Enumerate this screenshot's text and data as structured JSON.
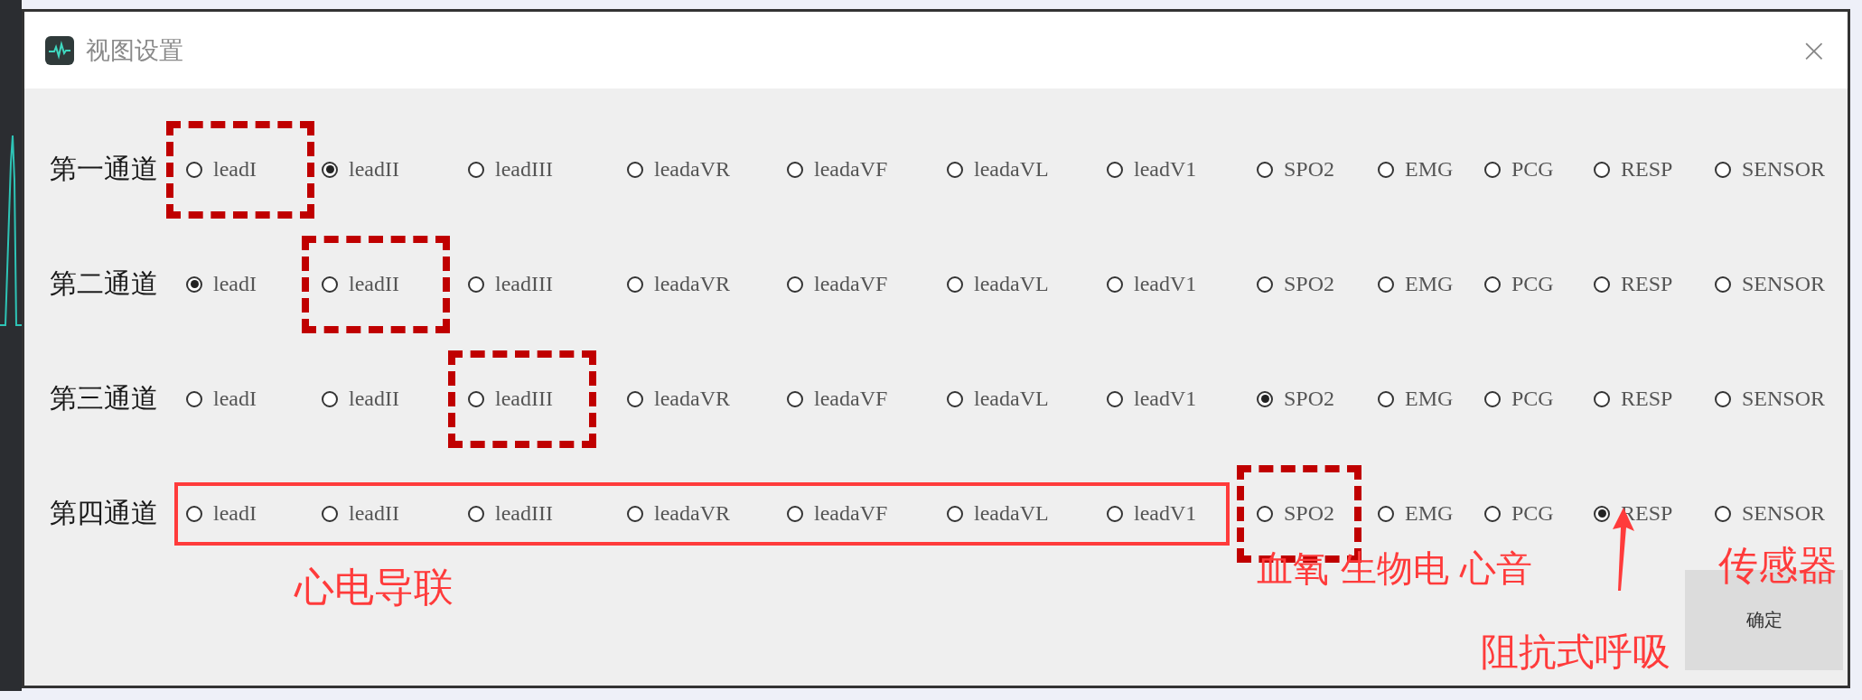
{
  "window": {
    "title": "视图设置",
    "close": "×"
  },
  "channels": [
    {
      "label": "第一通道",
      "options": [
        {
          "kind": "radio",
          "label": "leadI",
          "selected": false,
          "boxed": true
        },
        {
          "kind": "radio",
          "label": "leadII",
          "selected": true,
          "boxed": false
        },
        {
          "kind": "radio",
          "label": "leadIII",
          "selected": false,
          "boxed": false
        },
        {
          "kind": "radio",
          "label": "leadaVR",
          "selected": false,
          "boxed": false
        },
        {
          "kind": "radio",
          "label": "leadaVF",
          "selected": false,
          "boxed": false
        },
        {
          "kind": "radio",
          "label": "leadaVL",
          "selected": false,
          "boxed": false
        },
        {
          "kind": "radio",
          "label": "leadV1",
          "selected": false,
          "boxed": false
        },
        {
          "kind": "radio",
          "label": "SPO2",
          "selected": false,
          "boxed": false
        },
        {
          "kind": "radio",
          "label": "EMG",
          "selected": false,
          "boxed": false
        },
        {
          "kind": "radio",
          "label": "PCG",
          "selected": false,
          "boxed": false
        },
        {
          "kind": "radio",
          "label": "RESP",
          "selected": false,
          "boxed": false
        },
        {
          "kind": "radio",
          "label": "SENSOR",
          "selected": false,
          "boxed": false
        }
      ]
    },
    {
      "label": "第二通道",
      "options": [
        {
          "kind": "radio",
          "label": "leadI",
          "selected": true,
          "boxed": false
        },
        {
          "kind": "radio",
          "label": "leadII",
          "selected": false,
          "boxed": true
        },
        {
          "kind": "radio",
          "label": "leadIII",
          "selected": false,
          "boxed": false
        },
        {
          "kind": "radio",
          "label": "leadaVR",
          "selected": false,
          "boxed": false
        },
        {
          "kind": "radio",
          "label": "leadaVF",
          "selected": false,
          "boxed": false
        },
        {
          "kind": "radio",
          "label": "leadaVL",
          "selected": false,
          "boxed": false
        },
        {
          "kind": "radio",
          "label": "leadV1",
          "selected": false,
          "boxed": false
        },
        {
          "kind": "radio",
          "label": "SPO2",
          "selected": false,
          "boxed": false
        },
        {
          "kind": "radio",
          "label": "EMG",
          "selected": false,
          "boxed": false
        },
        {
          "kind": "radio",
          "label": "PCG",
          "selected": false,
          "boxed": false
        },
        {
          "kind": "radio",
          "label": "RESP",
          "selected": false,
          "boxed": false
        },
        {
          "kind": "radio",
          "label": "SENSOR",
          "selected": false,
          "boxed": false
        }
      ]
    },
    {
      "label": "第三通道",
      "options": [
        {
          "kind": "radio",
          "label": "leadI",
          "selected": false,
          "boxed": false
        },
        {
          "kind": "radio",
          "label": "leadII",
          "selected": false,
          "boxed": false
        },
        {
          "kind": "radio",
          "label": "leadIII",
          "selected": false,
          "boxed": true
        },
        {
          "kind": "radio",
          "label": "leadaVR",
          "selected": false,
          "boxed": false
        },
        {
          "kind": "radio",
          "label": "leadaVF",
          "selected": false,
          "boxed": false
        },
        {
          "kind": "radio",
          "label": "leadaVL",
          "selected": false,
          "boxed": false
        },
        {
          "kind": "radio",
          "label": "leadV1",
          "selected": false,
          "boxed": false
        },
        {
          "kind": "radio",
          "label": "SPO2",
          "selected": true,
          "boxed": false
        },
        {
          "kind": "radio",
          "label": "EMG",
          "selected": false,
          "boxed": false
        },
        {
          "kind": "radio",
          "label": "PCG",
          "selected": false,
          "boxed": false
        },
        {
          "kind": "radio",
          "label": "RESP",
          "selected": false,
          "boxed": false
        },
        {
          "kind": "radio",
          "label": "SENSOR",
          "selected": false,
          "boxed": false
        }
      ]
    },
    {
      "label": "第四通道",
      "options": [
        {
          "kind": "group",
          "options": [
            {
              "kind": "radio",
              "label": "leadI",
              "selected": false,
              "boxed": false
            },
            {
              "kind": "radio",
              "label": "leadII",
              "selected": false,
              "boxed": false
            },
            {
              "kind": "radio",
              "label": "leadIII",
              "selected": false,
              "boxed": false
            },
            {
              "kind": "radio",
              "label": "leadaVR",
              "selected": false,
              "boxed": false
            },
            {
              "kind": "radio",
              "label": "leadaVF",
              "selected": false,
              "boxed": false
            },
            {
              "kind": "radio",
              "label": "leadaVL",
              "selected": false,
              "boxed": false
            },
            {
              "kind": "radio",
              "label": "leadV1",
              "selected": false,
              "boxed": false
            }
          ]
        },
        {
          "kind": "radio",
          "label": "SPO2",
          "selected": false,
          "boxed": true
        },
        {
          "kind": "radio",
          "label": "EMG",
          "selected": false,
          "boxed": false
        },
        {
          "kind": "radio",
          "label": "PCG",
          "selected": false,
          "boxed": false
        },
        {
          "kind": "radio",
          "label": "RESP",
          "selected": true,
          "boxed": false
        },
        {
          "kind": "radio",
          "label": "SENSOR",
          "selected": false,
          "boxed": false
        }
      ]
    }
  ],
  "annotations": [
    {
      "kind": "caption",
      "text": "心电导联"
    },
    {
      "kind": "caption",
      "text": "血氧 生物电 心音"
    },
    {
      "kind": "arrow"
    },
    {
      "kind": "caption",
      "text": "阻抗式呼吸"
    },
    {
      "kind": "caption",
      "text": "传感器"
    }
  ],
  "buttons": [
    "确定"
  ]
}
